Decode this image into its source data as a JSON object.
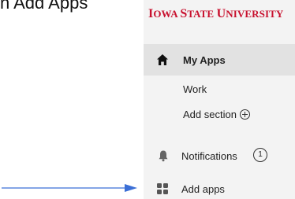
{
  "heading": {
    "text": "n Add Apps"
  },
  "university": {
    "first_I": "I",
    "owa": "OWA ",
    "first_S": "S",
    "tate": "TATE ",
    "first_U": "U",
    "niversity": "NIVERSITY"
  },
  "nav": {
    "my_apps": {
      "label": "My Apps",
      "icon": "home-icon"
    },
    "work": {
      "label": "Work"
    },
    "add_section": {
      "label": "Add section",
      "icon": "plus-circle-icon"
    },
    "notifications": {
      "label": "Notifications",
      "count": "1",
      "icon": "bell-icon"
    },
    "add_apps": {
      "label": "Add apps",
      "icon": "grid-icon"
    }
  },
  "annotation": {
    "arrow_color": "#3b6fd6"
  },
  "colors": {
    "brand_red": "#c8102e"
  }
}
